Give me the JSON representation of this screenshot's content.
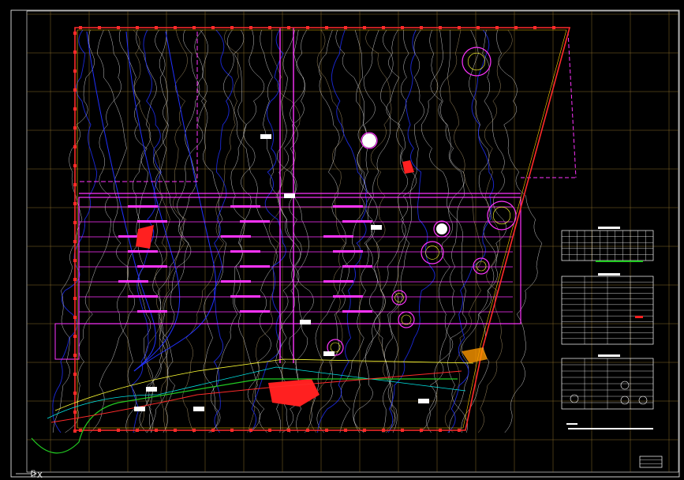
{
  "drawing": {
    "background": "#000000",
    "colors": {
      "frame": "#ffffff",
      "grid": "#8a6d2a",
      "boundary": "#ff2a2a",
      "boundary_inner": "#ffcc00",
      "roads": "#ff33ff",
      "contour_major": "#2030ff",
      "contour_minor": "#e8e8e8",
      "contour_tan": "#b8a070",
      "green": "#22cc22",
      "cyan": "#00e5e5",
      "yellow": "#ffff33",
      "orange": "#ff9900",
      "red_fill": "#ff2020"
    }
  },
  "ucs_icon": {
    "x_label": "X",
    "y_label": "Y",
    "icon": "ucs-axis-icon"
  },
  "legend_tables": {
    "table_1": {
      "title_icon": "table-header-icon"
    },
    "table_2": {
      "title_icon": "table-header-icon"
    },
    "table_3": {
      "title_icon": "table-header-icon"
    }
  }
}
